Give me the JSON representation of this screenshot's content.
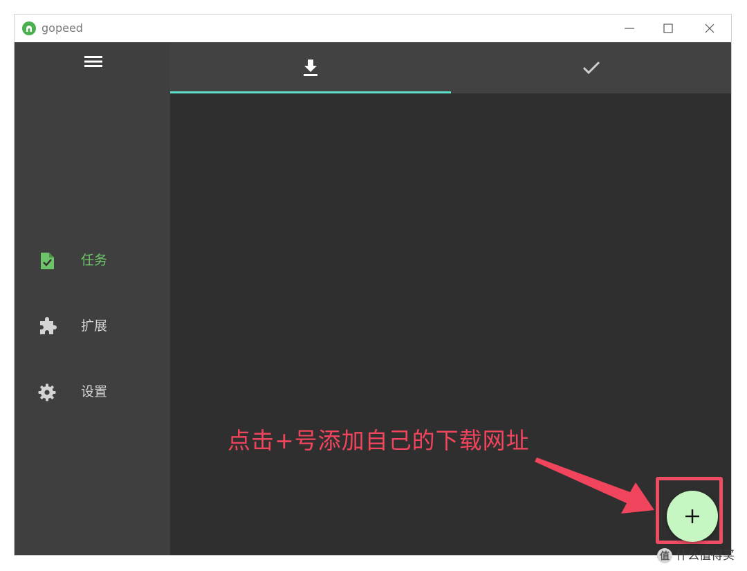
{
  "window": {
    "title": "gopeed"
  },
  "sidebar": {
    "items": [
      {
        "label": "任务",
        "icon": "task-file-icon",
        "active": true
      },
      {
        "label": "扩展",
        "icon": "puzzle-icon",
        "active": false
      },
      {
        "label": "设置",
        "icon": "gear-icon",
        "active": false
      }
    ]
  },
  "tabs": [
    {
      "icon": "download-icon",
      "active": true
    },
    {
      "icon": "check-icon",
      "active": false
    }
  ],
  "annotation": {
    "text": "点击+号添加自己的下载网址"
  },
  "fab": {
    "icon": "plus-icon"
  },
  "watermark": {
    "logo": "值",
    "text": "什么值得买"
  },
  "colors": {
    "accent": "#6ec46a",
    "tab_indicator": "#5fe0c8",
    "annotation": "#f0455c",
    "fab": "#c6f7c3"
  }
}
